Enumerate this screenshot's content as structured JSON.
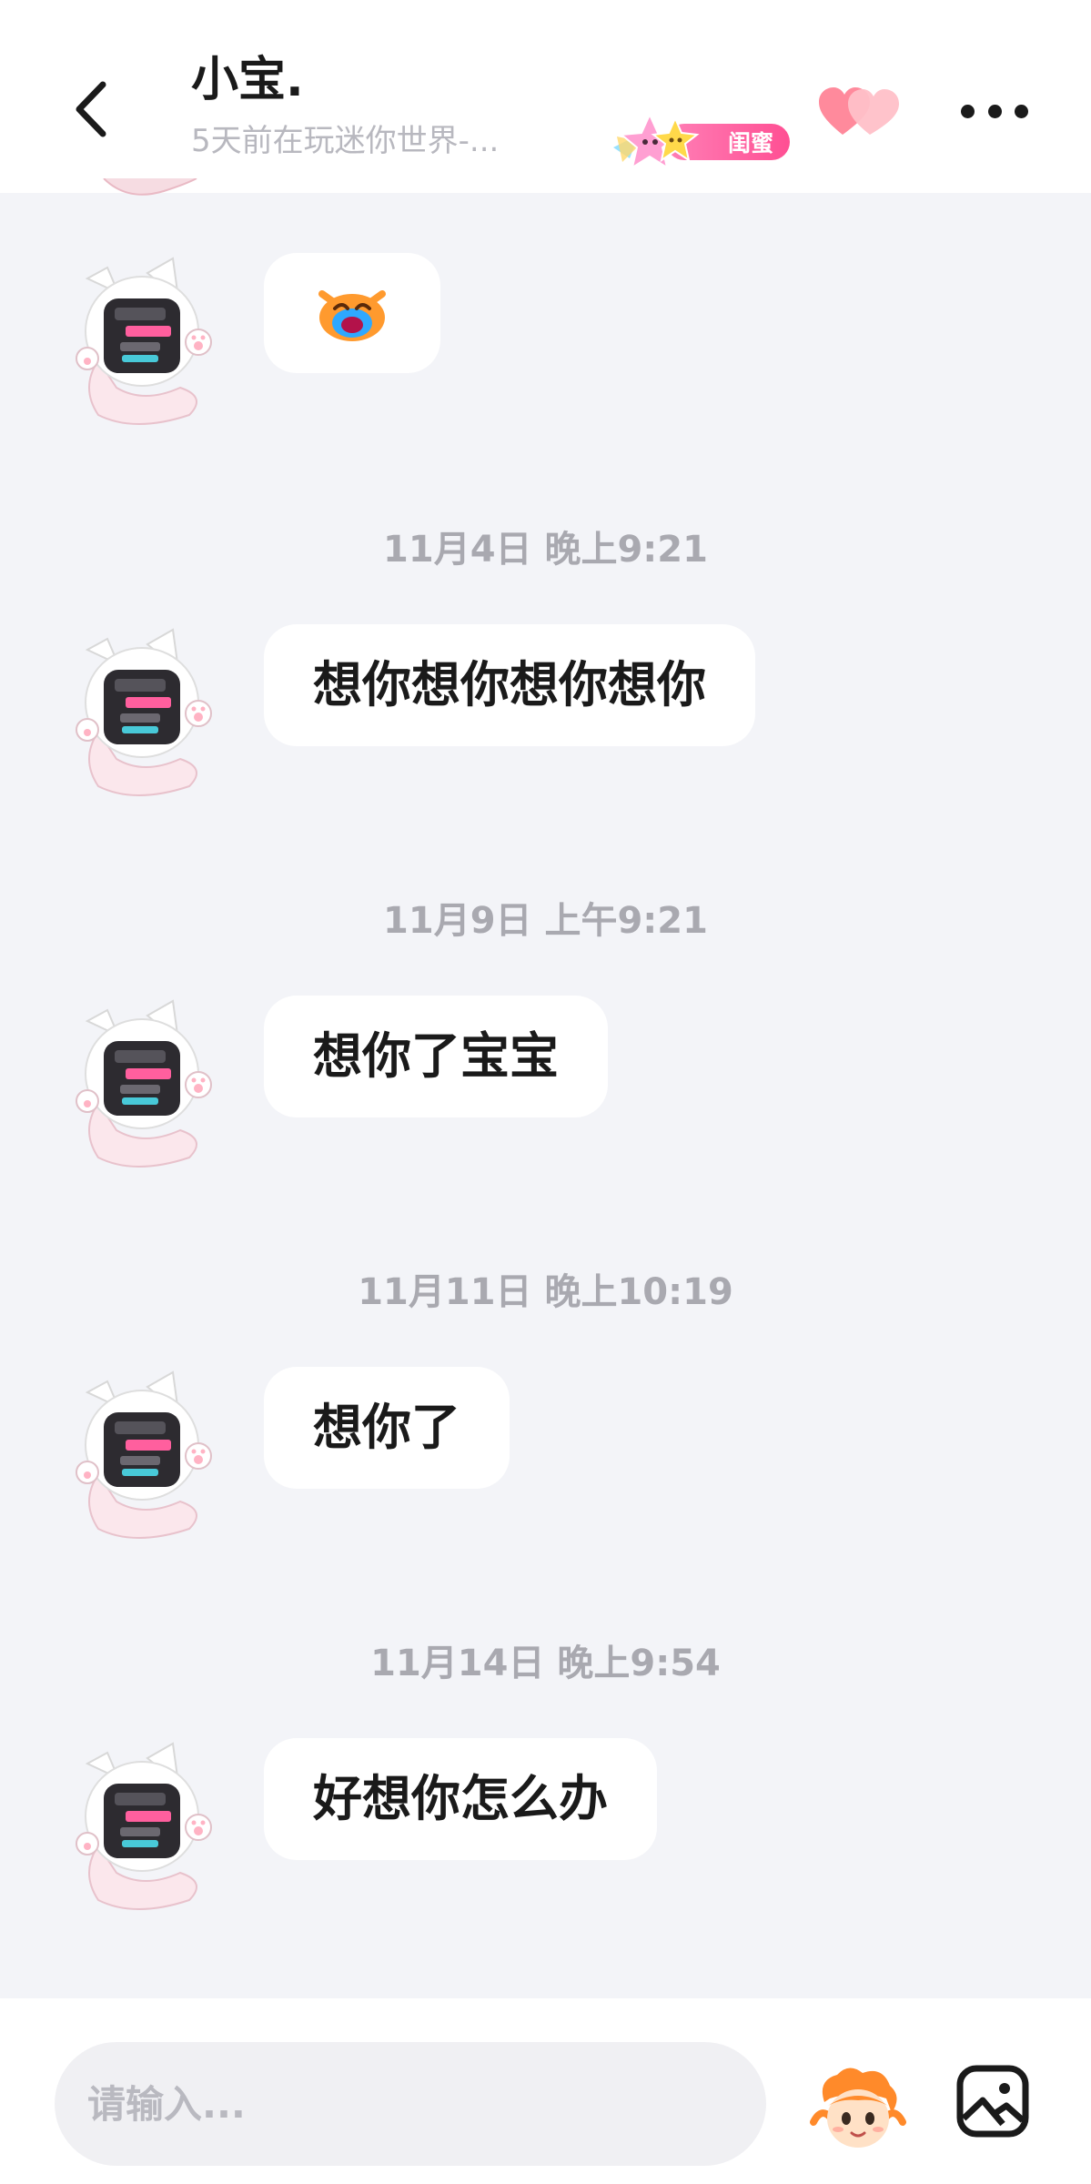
{
  "header": {
    "title": "小宝.",
    "subtitle": "5天前在玩迷你世界-...",
    "badge_label": "闺蜜",
    "icons": {
      "back": "chevron-left-icon",
      "hearts": "hearts-icon",
      "more": "more-dots-icon",
      "badge": "star-badge-icon"
    }
  },
  "messages": [
    {
      "type": "sticker",
      "sticker": "crying-face-sticker"
    },
    {
      "timestamp": "11月4日 晚上9:21",
      "text": "想你想你想你想你"
    },
    {
      "timestamp": "11月9日 上午9:21",
      "text": "想你了宝宝"
    },
    {
      "timestamp": "11月11日 晚上10:19",
      "text": "想你了"
    },
    {
      "timestamp": "11月14日 晚上9:54",
      "text": "好想你怎么办"
    }
  ],
  "input": {
    "placeholder": "请输入..."
  },
  "colors": {
    "background": "#f3f4f8",
    "bubble": "#ffffff",
    "badge_pink": "#ff4f93",
    "heart": "#ff7a8f",
    "timestamp": "#a9a9b0"
  }
}
